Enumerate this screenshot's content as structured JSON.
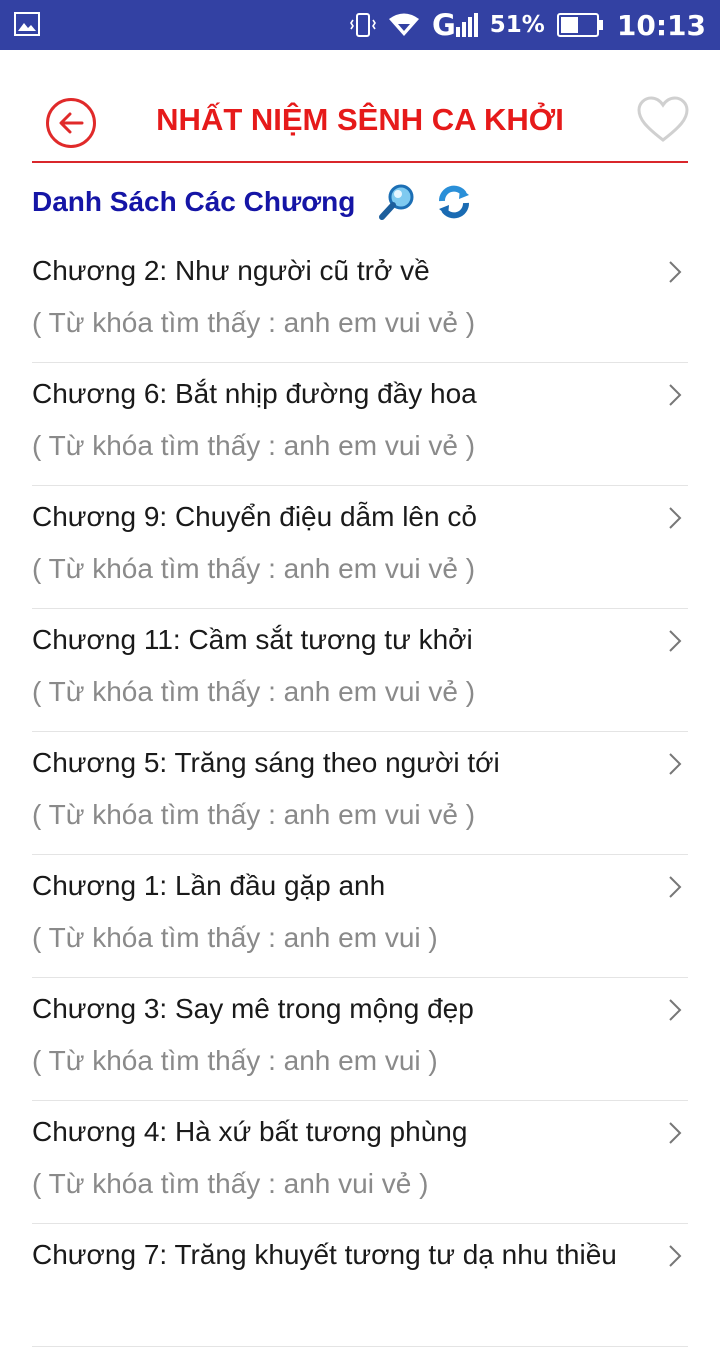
{
  "status_bar": {
    "signal_label": "G",
    "battery_percent": "51%",
    "battery_level": 0.51,
    "time": "10:13"
  },
  "header": {
    "title": "NHẤT NIỆM SÊNH CA KHỞI",
    "back_icon": "arrow-left-circle-icon",
    "favorite_icon": "heart-outline-icon",
    "accent_color": "#e61a1a"
  },
  "section": {
    "title": "Danh Sách Các Chương",
    "title_color": "#1515a6",
    "search_icon": "magnifier-icon",
    "refresh_icon": "refresh-icon"
  },
  "chapters": [
    {
      "title": "Chương 2: Như người cũ trở về",
      "keyword": "( Từ khóa tìm thấy : anh em vui vẻ  )"
    },
    {
      "title": "Chương 6: Bắt nhịp đường đầy hoa",
      "keyword": "( Từ khóa tìm thấy : anh em vui vẻ  )"
    },
    {
      "title": "Chương 9: Chuyển điệu dẫm lên cỏ",
      "keyword": "( Từ khóa tìm thấy : anh em vui vẻ  )"
    },
    {
      "title": "Chương 11: Cầm sắt tương tư khởi",
      "keyword": "( Từ khóa tìm thấy : anh em vui vẻ  )"
    },
    {
      "title": "Chương 5: Trăng sáng theo người tới",
      "keyword": "( Từ khóa tìm thấy : anh em vui vẻ  )"
    },
    {
      "title": "Chương 1: Lần đầu gặp anh",
      "keyword": "( Từ khóa tìm thấy : anh em vui  )"
    },
    {
      "title": "Chương 3: Say mê trong mộng đẹp",
      "keyword": "( Từ khóa tìm thấy : anh em vui  )"
    },
    {
      "title": "Chương 4: Hà xứ bất tương phùng",
      "keyword": "( Từ khóa tìm thấy : anh vui vẻ  )"
    },
    {
      "title": "Chương 7: Trăng khuyết tương tư dạ nhu thiều",
      "keyword": ""
    }
  ]
}
